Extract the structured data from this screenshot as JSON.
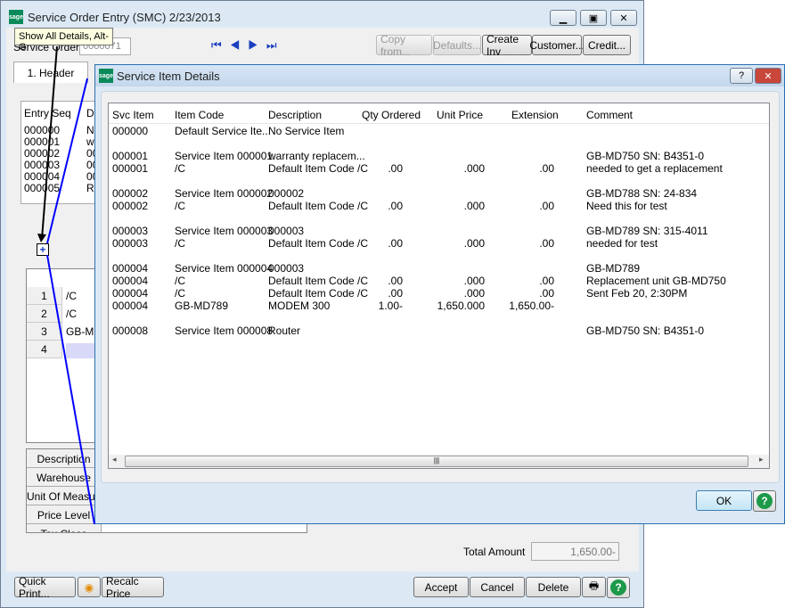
{
  "main": {
    "title": "Service Order Entry (SMC) 2/23/2013",
    "tooltip": "Show All Details, Alt-G",
    "service_order_label": "Service Order",
    "service_order_value": "0000071",
    "buttons": {
      "copy_from": "Copy from...",
      "defaults": "Defaults...",
      "create_inv": "Create Inv",
      "customer": "Customer...",
      "credit": "Credit..."
    },
    "tab_header": "1. Header",
    "entry_list": {
      "headers": [
        "Entry Seq",
        "D"
      ],
      "rows": [
        [
          "000000",
          "N"
        ],
        [
          "000001",
          "w"
        ],
        [
          "000002",
          "00"
        ],
        [
          "000003",
          "00"
        ],
        [
          "000004",
          "00"
        ],
        [
          "000005",
          "R"
        ]
      ]
    },
    "lines": [
      {
        "n": "1",
        "code": "/C"
      },
      {
        "n": "2",
        "code": "/C"
      },
      {
        "n": "3",
        "code": "GB-MD"
      },
      {
        "n": "4",
        "code": ""
      }
    ],
    "props": [
      "Description",
      "Warehouse",
      "Unit Of Measure",
      "Price Level",
      "Tax Class"
    ],
    "total_label": "Total Amount",
    "total_value": "1,650.00-",
    "footer": {
      "quick_print": "Quick Print...",
      "recalc": "Recalc Price",
      "accept": "Accept",
      "cancel": "Cancel",
      "delete": "Delete"
    }
  },
  "dialog": {
    "title": "Service Item Details",
    "ok": "OK",
    "headers": [
      "Svc Item",
      "Item Code",
      "Description",
      "Qty Ordered",
      "Unit Price",
      "Extension",
      "Comment"
    ],
    "rows": [
      [
        "000000",
        "Default Service Ite...",
        "No Service Item",
        "",
        "",
        "",
        ""
      ],
      null,
      [
        "000001",
        "Service Item 000001",
        "warranty replacem...",
        "",
        "",
        "",
        "GB-MD750 SN:  B4351-0"
      ],
      [
        "000001",
        "/C",
        "Default Item Code /C",
        ".00",
        ".000",
        ".00",
        "needed to get a replacement"
      ],
      null,
      [
        "000002",
        "Service Item 000002",
        "000002",
        "",
        "",
        "",
        "GB-MD788 SN:  24-834"
      ],
      [
        "000002",
        "/C",
        "Default Item Code /C",
        ".00",
        ".000",
        ".00",
        "Need this for test"
      ],
      null,
      [
        "000003",
        "Service Item 000003",
        "000003",
        "",
        "",
        "",
        "GB-MD789 SN:  315-4011"
      ],
      [
        "000003",
        "/C",
        "Default Item Code /C",
        ".00",
        ".000",
        ".00",
        "needed for test"
      ],
      null,
      [
        "000004",
        "Service Item 000004",
        "000003",
        "",
        "",
        "",
        "GB-MD789"
      ],
      [
        "000004",
        "/C",
        "Default Item Code /C",
        ".00",
        ".000",
        ".00",
        "Replacement unit GB-MD750"
      ],
      [
        "000004",
        "/C",
        "Default Item Code /C",
        ".00",
        ".000",
        ".00",
        "Sent Feb 20, 2:30PM"
      ],
      [
        "000004",
        "GB-MD789",
        "MODEM 300",
        "1.00-",
        "1,650.000",
        "1,650.00-",
        ""
      ],
      null,
      [
        "000008",
        "Service Item 000008",
        "Router",
        "",
        "",
        "",
        "GB-MD750 SN:  B4351-0"
      ]
    ]
  },
  "colors": {
    "annotation_line": "#0000ff",
    "arrow": "#000000",
    "sage": "#0a8a5a"
  }
}
